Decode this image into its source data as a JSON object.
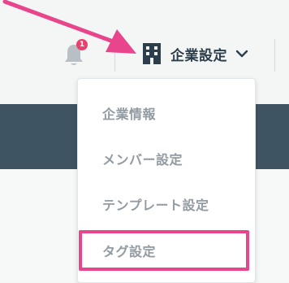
{
  "header": {
    "notification_count": "1",
    "company_menu_label": "企業設定"
  },
  "dropdown": {
    "items": [
      {
        "label": "企業情報"
      },
      {
        "label": "メンバー設定"
      },
      {
        "label": "テンプレート設定"
      },
      {
        "label": "タグ設定"
      }
    ],
    "highlighted_item": "タグ設定"
  },
  "colors": {
    "annotation": "#e8458c",
    "badge": "#e8416b",
    "band": "#3e5463",
    "menu_text": "#929ba2",
    "header_text": "#2c3e4c"
  }
}
